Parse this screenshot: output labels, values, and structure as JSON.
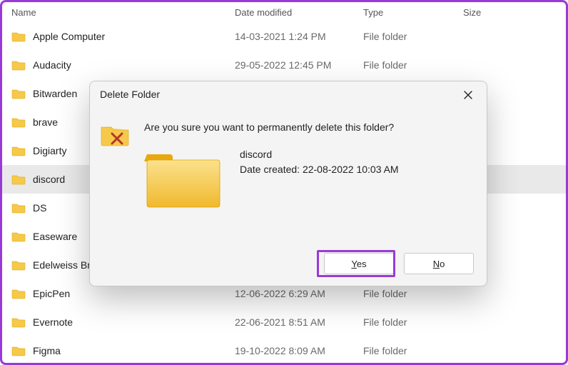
{
  "columns": {
    "name": "Name",
    "date": "Date modified",
    "type": "Type",
    "size": "Size"
  },
  "type_label": "File folder",
  "rows": [
    {
      "name": "Apple Computer",
      "date": "14-03-2021 1:24 PM",
      "selected": false,
      "hideMeta": false
    },
    {
      "name": "Audacity",
      "date": "29-05-2022 12:45 PM",
      "selected": false,
      "hideMeta": false
    },
    {
      "name": "Bitwarden",
      "date": "",
      "selected": false,
      "hideMeta": true
    },
    {
      "name": "brave",
      "date": "",
      "selected": false,
      "hideMeta": true
    },
    {
      "name": "Digiarty",
      "date": "",
      "selected": false,
      "hideMeta": true
    },
    {
      "name": "discord",
      "date": "",
      "selected": true,
      "hideMeta": true
    },
    {
      "name": "DS",
      "date": "",
      "selected": false,
      "hideMeta": true
    },
    {
      "name": "Easeware",
      "date": "",
      "selected": false,
      "hideMeta": true
    },
    {
      "name": "Edelweiss Bro",
      "date": "",
      "selected": false,
      "hideMeta": true
    },
    {
      "name": "EpicPen",
      "date": "12-06-2022 6:29 AM",
      "selected": false,
      "hideMeta": false
    },
    {
      "name": "Evernote",
      "date": "22-06-2021 8:51 AM",
      "selected": false,
      "hideMeta": false
    },
    {
      "name": "Figma",
      "date": "19-10-2022 8:09 AM",
      "selected": false,
      "hideMeta": false
    }
  ],
  "dialog": {
    "title": "Delete Folder",
    "prompt": "Are you sure you want to permanently delete this folder?",
    "item_name": "discord",
    "date_created_label": "Date created: 22-08-2022 10:03 AM",
    "yes": "Yes",
    "no": "No"
  }
}
